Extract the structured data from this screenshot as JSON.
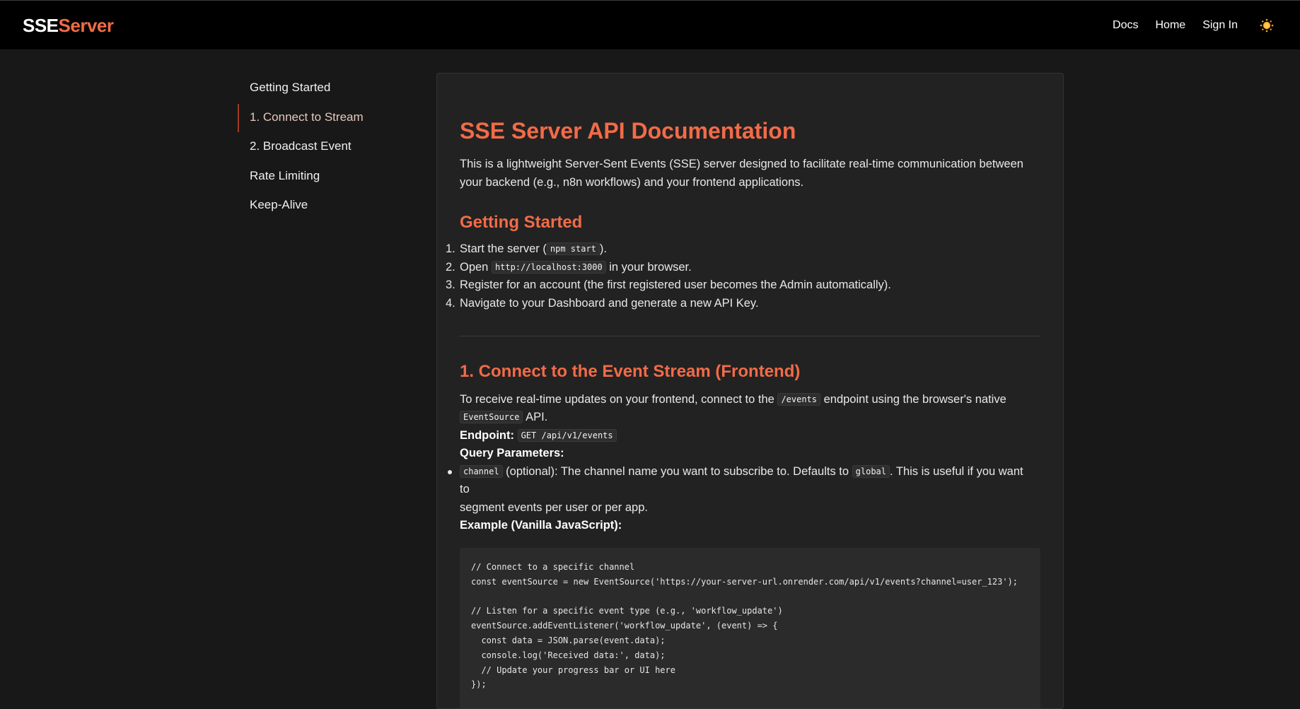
{
  "header": {
    "logo_part1": "SSE",
    "logo_part2": "Server",
    "nav": [
      "Docs",
      "Home",
      "Sign In"
    ],
    "theme_icon": "sun-icon"
  },
  "sidebar": {
    "items": [
      {
        "label": "Getting Started",
        "active": false
      },
      {
        "label": "1. Connect to Stream",
        "active": true
      },
      {
        "label": "2. Broadcast Event",
        "active": false
      },
      {
        "label": "Rate Limiting",
        "active": false
      },
      {
        "label": "Keep-Alive",
        "active": false
      }
    ]
  },
  "doc": {
    "title": "SSE Server API Documentation",
    "intro": "This is a lightweight Server-Sent Events (SSE) server designed to facilitate real-time communication between your backend (e.g., n8n workflows) and your frontend applications.",
    "getting_started": {
      "heading": "Getting Started",
      "steps": [
        {
          "n": "1.",
          "pre": "Start the server (",
          "code": "npm start",
          "post": ")."
        },
        {
          "n": "2.",
          "pre": "Open ",
          "code": "http://localhost:3000",
          "post": " in your browser."
        },
        {
          "n": "3.",
          "pre": "Register for an account (the first registered user becomes the Admin automatically).",
          "code": "",
          "post": ""
        },
        {
          "n": "4.",
          "pre": "Navigate to your Dashboard and generate a new API Key.",
          "code": "",
          "post": ""
        }
      ]
    },
    "connect": {
      "heading": "1. Connect to the Event Stream (Frontend)",
      "p1_pre": "To receive real-time updates on your frontend, connect to the ",
      "p1_code1": "/events",
      "p1_mid": " endpoint using the browser's native",
      "p1_code2": "EventSource",
      "p1_post": " API.",
      "endpoint_label": "Endpoint:",
      "endpoint_code": "GET /api/v1/events",
      "query_label": "Query Parameters:",
      "param_code": "channel",
      "param_text1": " (optional): The channel name you want to subscribe to. Defaults to ",
      "param_default": "global",
      "param_text2": ". This is useful if you want to",
      "param_text3": "segment events per user or per app.",
      "example_label": "Example (Vanilla JavaScript):",
      "code_block": "// Connect to a specific channel\nconst eventSource = new EventSource('https://your-server-url.onrender.com/api/v1/events?channel=user_123');\n\n// Listen for a specific event type (e.g., 'workflow_update')\neventSource.addEventListener('workflow_update', (event) => {\n  const data = JSON.parse(event.data);\n  console.log('Received data:', data);\n  // Update your progress bar or UI here\n});\n\n// Listen for the initial connection message event"
    }
  },
  "colors": {
    "accent": "#f26b48",
    "background": "#181818",
    "card": "#222222",
    "header": "#000000"
  }
}
